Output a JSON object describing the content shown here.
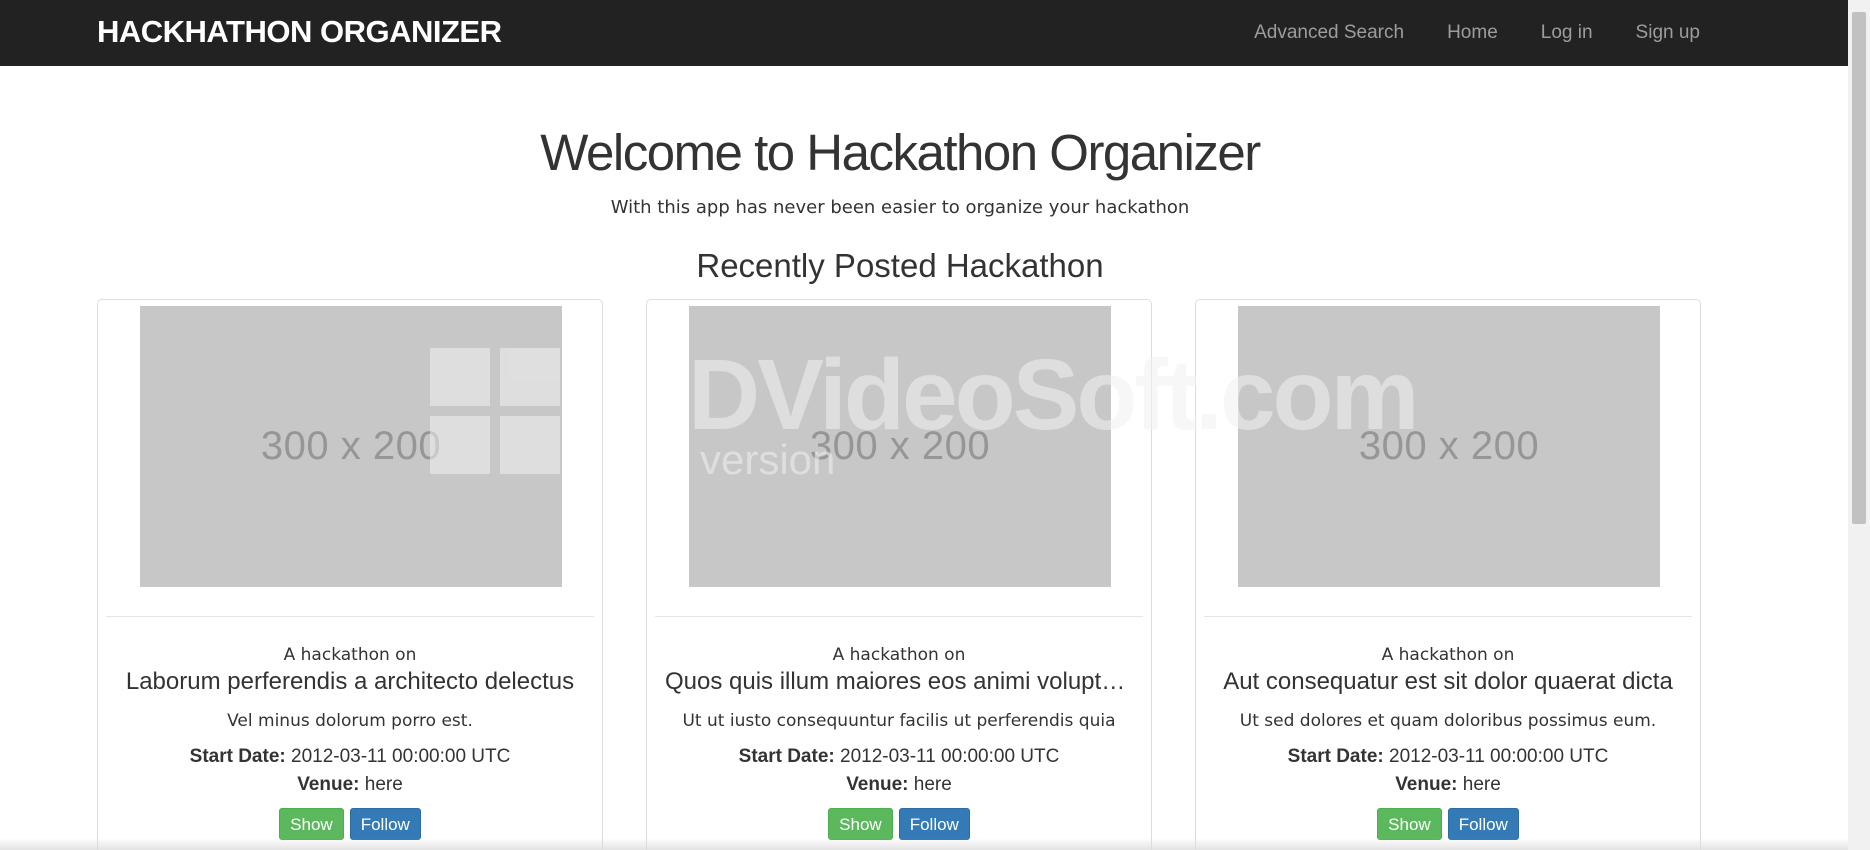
{
  "navbar": {
    "brand": "HACKHATHON ORGANIZER",
    "links": [
      {
        "label": "Advanced Search"
      },
      {
        "label": "Home"
      },
      {
        "label": "Log in"
      },
      {
        "label": "Sign up"
      }
    ]
  },
  "hero": {
    "title": "Welcome to Hackathon Organizer",
    "subtitle": "With this app has never been easier to organize your hackathon"
  },
  "section": {
    "title": "Recently Posted Hackathon"
  },
  "cards": [
    {
      "image_placeholder": "300 x 200",
      "prefix": "A hackathon on",
      "name": "Laborum perferendis a architecto delectus",
      "description": "Vel minus dolorum porro est.",
      "start_date_label": "Start Date:",
      "start_date": "2012-03-11 00:00:00 UTC",
      "venue_label": "Venue:",
      "venue": "here",
      "show_label": "Show",
      "follow_label": "Follow"
    },
    {
      "image_placeholder": "300 x 200",
      "prefix": "A hackathon on",
      "name": "Quos quis illum maiores eos animi voluptatem",
      "description": "Ut ut iusto consequuntur facilis ut perferendis quia",
      "start_date_label": "Start Date:",
      "start_date": "2012-03-11 00:00:00 UTC",
      "venue_label": "Venue:",
      "venue": "here",
      "show_label": "Show",
      "follow_label": "Follow"
    },
    {
      "image_placeholder": "300 x 200",
      "prefix": "A hackathon on",
      "name": "Aut consequatur est sit dolor quaerat dicta",
      "description": "Ut sed dolores et quam doloribus possimus eum.",
      "start_date_label": "Start Date:",
      "start_date": "2012-03-11 00:00:00 UTC",
      "venue_label": "Venue:",
      "venue": "here",
      "show_label": "Show",
      "follow_label": "Follow"
    }
  ],
  "watermark": {
    "text": "DVideoSoft.com",
    "subtext": "version"
  }
}
